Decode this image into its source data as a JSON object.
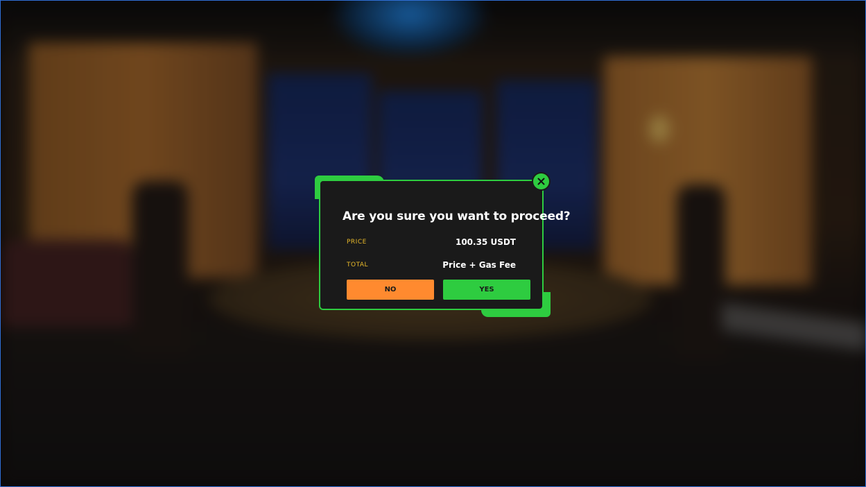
{
  "dialog": {
    "title": "Are you sure you want to proceed?",
    "price_label": "PRICE",
    "price_value": "100.35 USDT",
    "total_label": "TOTAL",
    "total_value": "Price + Gas Fee",
    "no_label": "NO",
    "yes_label": "YES",
    "close_icon": "close-icon"
  },
  "colors": {
    "accent_green": "#2ecc40",
    "no_orange": "#ff8a2f",
    "label_yellow": "#e8b92a",
    "panel_bg": "#1a1a1a"
  }
}
